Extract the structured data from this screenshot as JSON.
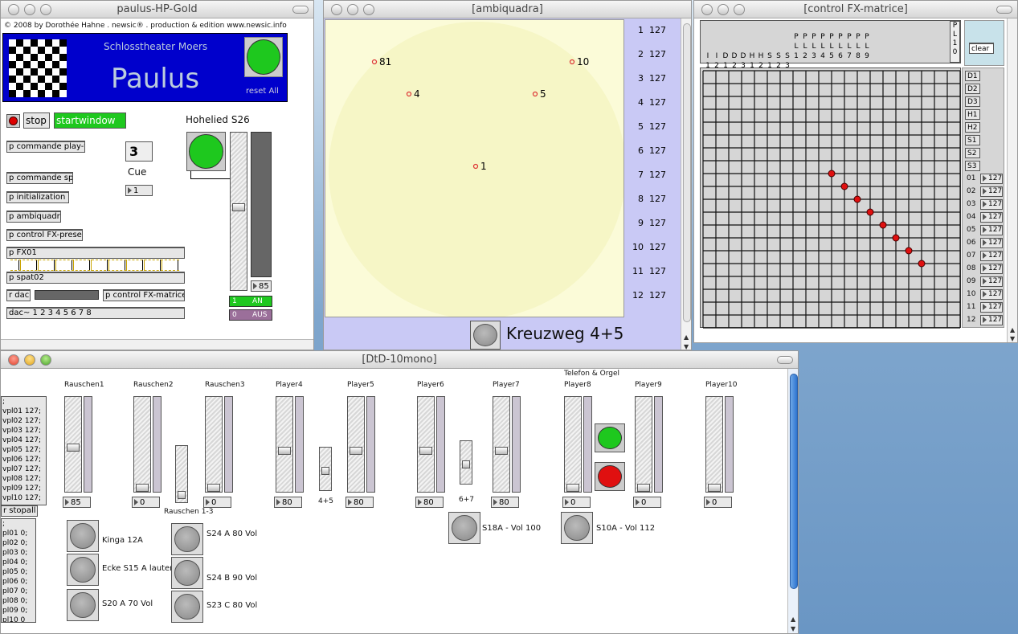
{
  "paulus": {
    "title": "paulus-HP-Gold",
    "copyright": "© 2008 by Dorothée Hahne . newsic® . production & edition www.newsic.info",
    "venue": "Schlosstheater Moers",
    "name": "Paulus",
    "reset_label": "reset All",
    "stop_label": "stop",
    "startwindow_label": "startwindow",
    "cue_number": "3",
    "cue_label": "Cue",
    "cue_value": "1",
    "section_title": "Hohelied S26",
    "slider_value": "85",
    "an_label": "AN",
    "an_value": "1",
    "aus_label": "AUS",
    "aus_value": "0",
    "objects": [
      "p commande play-fx",
      "p commande spat",
      "p initialization",
      "p ambiquadra",
      "p control FX-preset",
      "p FX01",
      "p spat02",
      "r dac",
      "p control FX-matrice",
      "dac~ 1 2 3 4 5 6 7 8"
    ],
    "colors": {
      "blue": "#0000cc",
      "green": "#1ec81e"
    }
  },
  "ambiquadra": {
    "title": "[ambiquadra]",
    "points": [
      {
        "label": "81"
      },
      {
        "label": "10"
      },
      {
        "label": "4"
      },
      {
        "label": "5"
      },
      {
        "label": "1"
      }
    ],
    "channels": [
      {
        "n": "1",
        "v": "127"
      },
      {
        "n": "2",
        "v": "127"
      },
      {
        "n": "3",
        "v": "127"
      },
      {
        "n": "4",
        "v": "127"
      },
      {
        "n": "5",
        "v": "127"
      },
      {
        "n": "6",
        "v": "127"
      },
      {
        "n": "7",
        "v": "127"
      },
      {
        "n": "8",
        "v": "127"
      },
      {
        "n": "9",
        "v": "127"
      },
      {
        "n": "10",
        "v": "127"
      },
      {
        "n": "11",
        "v": "127"
      },
      {
        "n": "12",
        "v": "127"
      }
    ],
    "footer_label": "Kreuzweg 4+5"
  },
  "matrix": {
    "title": "[control FX-matrice]",
    "header_cols": [
      [
        "I",
        "1"
      ],
      [
        "I",
        "2"
      ],
      [
        "D",
        "1"
      ],
      [
        "D",
        "2"
      ],
      [
        "D",
        "3"
      ],
      [
        "H",
        "1"
      ],
      [
        "H",
        "2"
      ],
      [
        "S",
        "1"
      ],
      [
        "S",
        "2"
      ],
      [
        "S",
        "3"
      ],
      [
        "P",
        "L",
        "1"
      ],
      [
        "P",
        "L",
        "2"
      ],
      [
        "P",
        "L",
        "3"
      ],
      [
        "P",
        "L",
        "4"
      ],
      [
        "P",
        "L",
        "5"
      ],
      [
        "P",
        "L",
        "6"
      ],
      [
        "P",
        "L",
        "7"
      ],
      [
        "P",
        "L",
        "8"
      ],
      [
        "P",
        "L",
        "9"
      ]
    ],
    "header_last": [
      "P",
      "L",
      "1",
      "0"
    ],
    "clear_label": "clear",
    "row_labels": [
      "D1",
      "D2",
      "D3",
      "H1",
      "H2",
      "S1",
      "S2",
      "S3"
    ],
    "out_rows": [
      {
        "n": "01",
        "v": "127"
      },
      {
        "n": "02",
        "v": "127"
      },
      {
        "n": "03",
        "v": "127"
      },
      {
        "n": "04",
        "v": "127"
      },
      {
        "n": "05",
        "v": "127"
      },
      {
        "n": "06",
        "v": "127"
      },
      {
        "n": "07",
        "v": "127"
      },
      {
        "n": "08",
        "v": "127"
      },
      {
        "n": "09",
        "v": "127"
      },
      {
        "n": "10",
        "v": "127"
      },
      {
        "n": "11",
        "v": "127"
      },
      {
        "n": "12",
        "v": "127"
      }
    ],
    "active_cells": [
      [
        10,
        8
      ],
      [
        11,
        9
      ],
      [
        12,
        10
      ],
      [
        13,
        11
      ],
      [
        14,
        12
      ],
      [
        15,
        13
      ],
      [
        16,
        14
      ],
      [
        17,
        15
      ]
    ]
  },
  "dtd": {
    "title": "[DtD-10mono]",
    "channels": [
      {
        "name": "Rauschen1",
        "value": "85",
        "level": 0.46
      },
      {
        "name": "Rauschen2",
        "value": "0",
        "level": 0.0
      },
      {
        "name": "Rauschen3",
        "value": "0",
        "level": 0.0
      },
      {
        "name": "Player4",
        "value": "80",
        "level": 0.43
      },
      {
        "name": "Player5",
        "value": "80",
        "level": 0.43
      },
      {
        "name": "Player6",
        "value": "80",
        "level": 0.43
      },
      {
        "name": "Player7",
        "value": "80",
        "level": 0.43
      },
      {
        "name": "Player8",
        "value": "0",
        "level": 0.0
      },
      {
        "name": "Player9",
        "value": "0",
        "level": 0.0
      },
      {
        "name": "Player10",
        "value": "0",
        "level": 0.0
      }
    ],
    "telefon_label": "Telefon & Orgel",
    "group_labels": [
      "Rauschen 1-3",
      "4+5",
      "6+7"
    ],
    "message_vol": [
      ";",
      "vpl01 127;",
      "vpl02 127;",
      "vpl03 127;",
      "vpl04 127;",
      "vpl05 127;",
      "vpl06 127;",
      "vpl07 127;",
      "vpl08 127;",
      "vpl09 127;",
      "vpl10 127;"
    ],
    "stopall_label": "r stopall",
    "message_stop": [
      ";",
      "pl01 0;",
      "pl02 0;",
      "pl03 0;",
      "pl04 0;",
      "pl05 0;",
      "pl06 0;",
      "pl07 0;",
      "pl08 0;",
      "pl09 0;",
      "pl10 0"
    ],
    "cue_buttons": [
      {
        "label": "Kinga 12A"
      },
      {
        "label": "Ecke S15 A lauter"
      },
      {
        "label": "S20 A 70 Vol"
      },
      {
        "label": "S24 A 80 Vol"
      },
      {
        "label": "S24 B 90 Vol"
      },
      {
        "label": "S23 C 80 Vol"
      },
      {
        "label": "S18A - Vol 100"
      },
      {
        "label": "S10A - Vol 112"
      }
    ]
  }
}
